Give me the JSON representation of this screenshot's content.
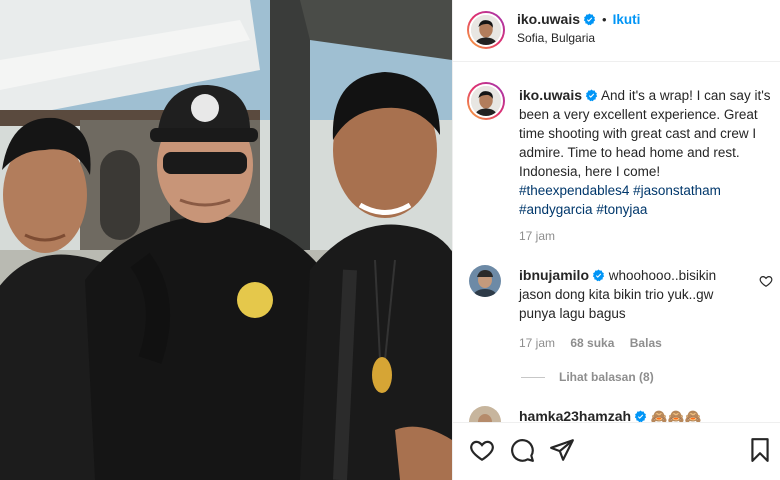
{
  "post": {
    "author": "iko.uwais",
    "follow_label": "Ikuti",
    "location": "Sofia, Bulgaria"
  },
  "caption": {
    "author": "iko.uwais",
    "text": "And it's a wrap! I can say it's been a very excellent experience. Great time shooting with great cast and crew I admire. Time to head home and rest. Indonesia, here I come!",
    "hashtags": [
      "#theexpendables4",
      "#jasonstatham",
      "#andygarcia",
      "#tonyjaa"
    ],
    "time": "17 jam"
  },
  "comments": [
    {
      "author": "ibnujamilo",
      "text": "whoohooo..bisikin jason dong kita bikin trio yuk..gw punya lagu bagus",
      "time": "17 jam",
      "likes": "68 suka",
      "reply_label": "Balas",
      "view_replies": "Lihat balasan (8)"
    },
    {
      "author": "hamka23hamzah",
      "text": "🙈🙈🙈"
    }
  ],
  "icons": {
    "verified": "verified-badge-icon",
    "like_comment": "heart-outline-icon",
    "like": "heart-icon",
    "comment": "comment-icon",
    "share": "paper-plane-icon",
    "save": "bookmark-icon"
  },
  "colors": {
    "accent": "#0095f6",
    "hashtag": "#00376b",
    "muted": "#8e8e8e",
    "text": "#262626"
  }
}
